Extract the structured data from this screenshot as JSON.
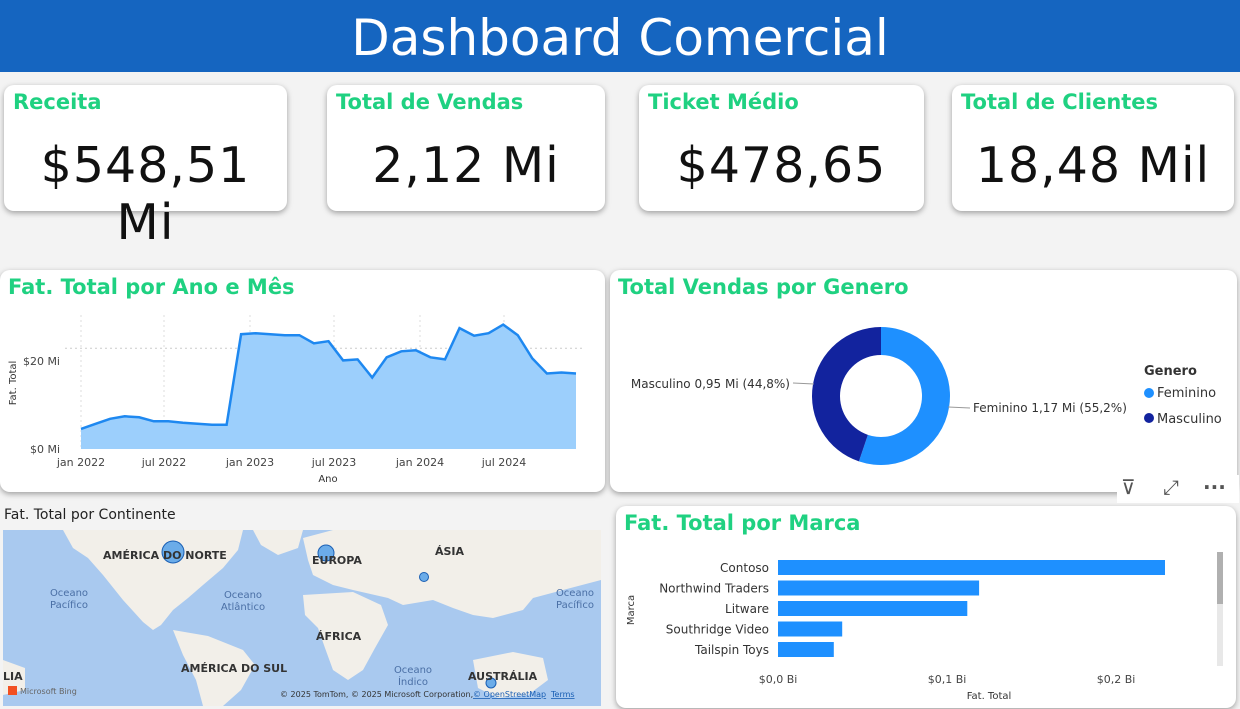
{
  "header": {
    "title": "Dashboard Comercial"
  },
  "kpis": [
    {
      "label": "Receita",
      "value": "$548,51 Mi"
    },
    {
      "label": "Total de Vendas",
      "value": "2,12 Mi"
    },
    {
      "label": "Ticket Médio",
      "value": "$478,65"
    },
    {
      "label": "Total de Clientes",
      "value": "18,48 Mil"
    }
  ],
  "line_panel": {
    "title": "Fat. Total por Ano e Mês",
    "ylabel": "Fat. Total",
    "xlabel": "Ano",
    "y_ticks": [
      "$20 Mi",
      "$0 Mi"
    ],
    "x_ticks": [
      "jan 2022",
      "jul 2022",
      "jan 2023",
      "jul 2023",
      "jan 2024",
      "jul 2024"
    ]
  },
  "donut_panel": {
    "title": "Total Vendas por Genero",
    "legend_title": "Genero",
    "label_masculino": "Masculino 0,95 Mi (44,8%)",
    "label_feminino": "Feminino 1,17 Mi (55,2%)",
    "legend_feminino": "Feminino",
    "legend_masculino": "Masculino"
  },
  "map_panel": {
    "title": "Fat. Total por Continente",
    "labels": {
      "na": "AMÉRICA DO NORTE",
      "europa": "EUROPA",
      "asia": "ÁSIA",
      "africa": "ÁFRICA",
      "sa": "AMÉRICA DO SUL",
      "australia": "AUSTRÁLIA",
      "lia": "LIA",
      "op1": "Oceano",
      "op2": "Pacífico",
      "oa1": "Oceano",
      "oa2": "Atlântico",
      "oi1": "Oceano",
      "oi2": "Índico",
      "opr1": "Oceano",
      "opr2": "Pacífico"
    },
    "attribution": "© 2025 TomTom, © 2025 Microsoft Corporation,",
    "osm": "© OpenStreetMap",
    "terms": "Terms",
    "logo_text": "Microsoft Bing"
  },
  "bar_panel": {
    "title": "Fat. Total por Marca",
    "ylabel": "Marca",
    "xlabel": "Fat. Total",
    "x_ticks": [
      "$0,0 Bi",
      "$0,1 Bi",
      "$0,2 Bi"
    ]
  },
  "toolbar": {
    "filter_glyph": "⊽",
    "focus_glyph": "⤢",
    "more_glyph": "···"
  },
  "colors": {
    "accent": "#1fd181",
    "header": "#1565c0",
    "line": "#1e88f0",
    "area": "#9ccffc",
    "feminino": "#1e90ff",
    "masculino": "#12239e",
    "bar": "#1e90ff"
  },
  "chart_data": [
    {
      "type": "area",
      "title": "Fat. Total por Ano e Mês",
      "xlabel": "Ano",
      "ylabel": "Fat. Total",
      "x": [
        "jan 2022",
        "fev 2022",
        "mar 2022",
        "abr 2022",
        "mai 2022",
        "jun 2022",
        "jul 2022",
        "ago 2022",
        "set 2022",
        "out 2022",
        "nov 2022",
        "dez 2022",
        "jan 2023",
        "fev 2023",
        "mar 2023",
        "abr 2023",
        "mai 2023",
        "jun 2023",
        "jul 2023",
        "ago 2023",
        "set 2023",
        "out 2023",
        "nov 2023",
        "dez 2023",
        "jan 2024",
        "fev 2024",
        "mar 2024",
        "abr 2024",
        "mai 2024",
        "jun 2024",
        "jul 2024",
        "ago 2024",
        "set 2024",
        "out 2024",
        "nov 2024",
        "dez 2024"
      ],
      "values": [
        4,
        5,
        6,
        6.5,
        6.3,
        5.5,
        5.5,
        5.2,
        5,
        4.8,
        4.8,
        22.8,
        23,
        22.8,
        22.6,
        22.6,
        21,
        21.4,
        17.6,
        17.8,
        14.2,
        18.2,
        19.4,
        19.6,
        18.2,
        17.8,
        24,
        22.5,
        23,
        24.7,
        22.6,
        18,
        15,
        15.2,
        15
      ],
      "ylim": [
        0,
        28
      ],
      "grid": true
    },
    {
      "type": "pie",
      "title": "Total Vendas por Genero",
      "categories": [
        "Feminino",
        "Masculino"
      ],
      "values": [
        1.17,
        0.95
      ],
      "percent": [
        55.2,
        44.8
      ]
    },
    {
      "type": "bar",
      "title": "Fat. Total por Marca",
      "categories": [
        "Contoso",
        "Northwind Traders",
        "Litware",
        "Southridge Video",
        "Tailspin Toys"
      ],
      "values": [
        0.229,
        0.119,
        0.112,
        0.038,
        0.033
      ],
      "xlim": [
        0,
        0.24
      ],
      "xlabel": "Fat. Total",
      "ylabel": "Marca"
    }
  ]
}
